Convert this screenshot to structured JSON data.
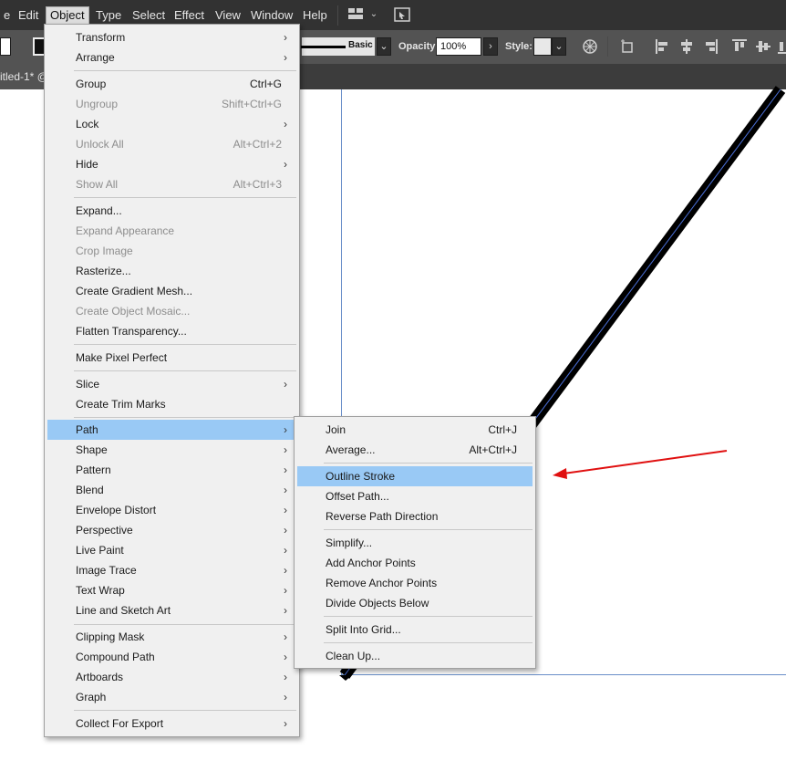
{
  "menubar": {
    "items": [
      "e",
      "Edit",
      "Object",
      "Type",
      "Select",
      "Effect",
      "View",
      "Window",
      "Help"
    ]
  },
  "control_bar": {
    "stroke_style": "Basic",
    "opacity_label": "Opacity:",
    "opacity_value": "100%",
    "style_label": "Style:"
  },
  "document_tab": {
    "title": "itled-1* @"
  },
  "object_menu": {
    "items": [
      {
        "label": "Transform",
        "shortcut": "",
        "submenu": true,
        "disabled": false
      },
      {
        "label": "Arrange",
        "shortcut": "",
        "submenu": true,
        "disabled": false
      },
      {
        "label": "Group",
        "shortcut": "Ctrl+G",
        "submenu": false,
        "disabled": false
      },
      {
        "label": "Ungroup",
        "shortcut": "Shift+Ctrl+G",
        "submenu": false,
        "disabled": true
      },
      {
        "label": "Lock",
        "shortcut": "",
        "submenu": true,
        "disabled": false
      },
      {
        "label": "Unlock All",
        "shortcut": "Alt+Ctrl+2",
        "submenu": false,
        "disabled": true
      },
      {
        "label": "Hide",
        "shortcut": "",
        "submenu": true,
        "disabled": false
      },
      {
        "label": "Show All",
        "shortcut": "Alt+Ctrl+3",
        "submenu": false,
        "disabled": true
      },
      {
        "label": "Expand...",
        "shortcut": "",
        "submenu": false,
        "disabled": false
      },
      {
        "label": "Expand Appearance",
        "shortcut": "",
        "submenu": false,
        "disabled": true
      },
      {
        "label": "Crop Image",
        "shortcut": "",
        "submenu": false,
        "disabled": true
      },
      {
        "label": "Rasterize...",
        "shortcut": "",
        "submenu": false,
        "disabled": false
      },
      {
        "label": "Create Gradient Mesh...",
        "shortcut": "",
        "submenu": false,
        "disabled": false
      },
      {
        "label": "Create Object Mosaic...",
        "shortcut": "",
        "submenu": false,
        "disabled": true
      },
      {
        "label": "Flatten Transparency...",
        "shortcut": "",
        "submenu": false,
        "disabled": false
      },
      {
        "label": "Make Pixel Perfect",
        "shortcut": "",
        "submenu": false,
        "disabled": false
      },
      {
        "label": "Slice",
        "shortcut": "",
        "submenu": true,
        "disabled": false
      },
      {
        "label": "Create Trim Marks",
        "shortcut": "",
        "submenu": false,
        "disabled": false
      },
      {
        "label": "Path",
        "shortcut": "",
        "submenu": true,
        "disabled": false,
        "highlighted": true
      },
      {
        "label": "Shape",
        "shortcut": "",
        "submenu": true,
        "disabled": false
      },
      {
        "label": "Pattern",
        "shortcut": "",
        "submenu": true,
        "disabled": false
      },
      {
        "label": "Blend",
        "shortcut": "",
        "submenu": true,
        "disabled": false
      },
      {
        "label": "Envelope Distort",
        "shortcut": "",
        "submenu": true,
        "disabled": false
      },
      {
        "label": "Perspective",
        "shortcut": "",
        "submenu": true,
        "disabled": false
      },
      {
        "label": "Live Paint",
        "shortcut": "",
        "submenu": true,
        "disabled": false
      },
      {
        "label": "Image Trace",
        "shortcut": "",
        "submenu": true,
        "disabled": false
      },
      {
        "label": "Text Wrap",
        "shortcut": "",
        "submenu": true,
        "disabled": false
      },
      {
        "label": "Line and Sketch Art",
        "shortcut": "",
        "submenu": true,
        "disabled": false
      },
      {
        "label": "Clipping Mask",
        "shortcut": "",
        "submenu": true,
        "disabled": false
      },
      {
        "label": "Compound Path",
        "shortcut": "",
        "submenu": true,
        "disabled": false
      },
      {
        "label": "Artboards",
        "shortcut": "",
        "submenu": true,
        "disabled": false
      },
      {
        "label": "Graph",
        "shortcut": "",
        "submenu": true,
        "disabled": false
      },
      {
        "label": "Collect For Export",
        "shortcut": "",
        "submenu": true,
        "disabled": false
      }
    ]
  },
  "path_submenu": {
    "items": [
      {
        "label": "Join",
        "shortcut": "Ctrl+J"
      },
      {
        "label": "Average...",
        "shortcut": "Alt+Ctrl+J"
      },
      {
        "label": "Outline Stroke",
        "shortcut": "",
        "highlighted": true
      },
      {
        "label": "Offset Path...",
        "shortcut": ""
      },
      {
        "label": "Reverse Path Direction",
        "shortcut": ""
      },
      {
        "label": "Simplify...",
        "shortcut": ""
      },
      {
        "label": "Add Anchor Points",
        "shortcut": ""
      },
      {
        "label": "Remove Anchor Points",
        "shortcut": ""
      },
      {
        "label": "Divide Objects Below",
        "shortcut": ""
      },
      {
        "label": "Split Into Grid...",
        "shortcut": ""
      },
      {
        "label": "Clean Up...",
        "shortcut": ""
      }
    ]
  },
  "colors": {
    "highlight": "#99c9f5",
    "annotation_arrow": "#e01010",
    "guide_line": "#4a6fd8"
  }
}
